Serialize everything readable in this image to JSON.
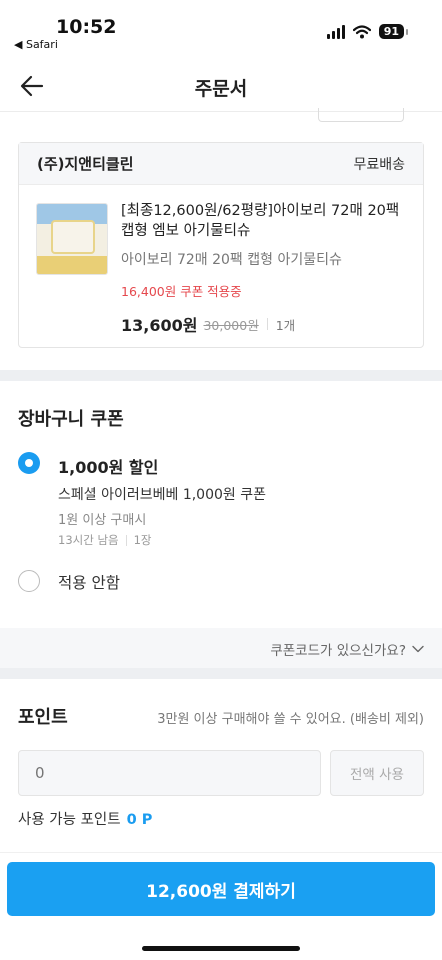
{
  "status_bar": {
    "time": "10:52",
    "back_app": "◀ Safari",
    "battery": "91"
  },
  "nav": {
    "title": "주문서",
    "back_icon": "arrow-left-icon"
  },
  "order_item": {
    "shop_name": "(주)지앤티클린",
    "shipping": "무료배송",
    "product_title": "[최종12,600원/62평량]아이보리 72매 20팩 캡형 엠보 아기물티슈",
    "option": "아이보리 72매 20팩 캡형 아기물티슈",
    "coupon_applied": "16,400원 쿠폰 적용중",
    "price_final": "13,600원",
    "price_original": "30,000원",
    "quantity": "1개"
  },
  "cart_coupon": {
    "title": "장바구니 쿠폰",
    "options": [
      {
        "amount": "1,000원 할인",
        "name": "스페셜 아이러브베베 1,000원 쿠폰",
        "condition": "1원 이상 구매시",
        "time_left": "13시간 남음",
        "count": "1장",
        "selected": true
      }
    ],
    "none_label": "적용 안함",
    "coupon_code_link": "쿠폰코드가 있으신가요?"
  },
  "points": {
    "title": "포인트",
    "note": "3만원 이상 구매해야 쓸 수 있어요. (배송비 제외)",
    "input_placeholder": "0",
    "use_all_label": "전액 사용",
    "available_label": "사용 가능 포인트",
    "available_value": "0 P"
  },
  "checkout": {
    "pay_label": "12,600원 결제하기"
  },
  "colors": {
    "accent": "#1aa0f2",
    "coupon_red": "#e5484d",
    "section_gray": "#edeff2"
  }
}
